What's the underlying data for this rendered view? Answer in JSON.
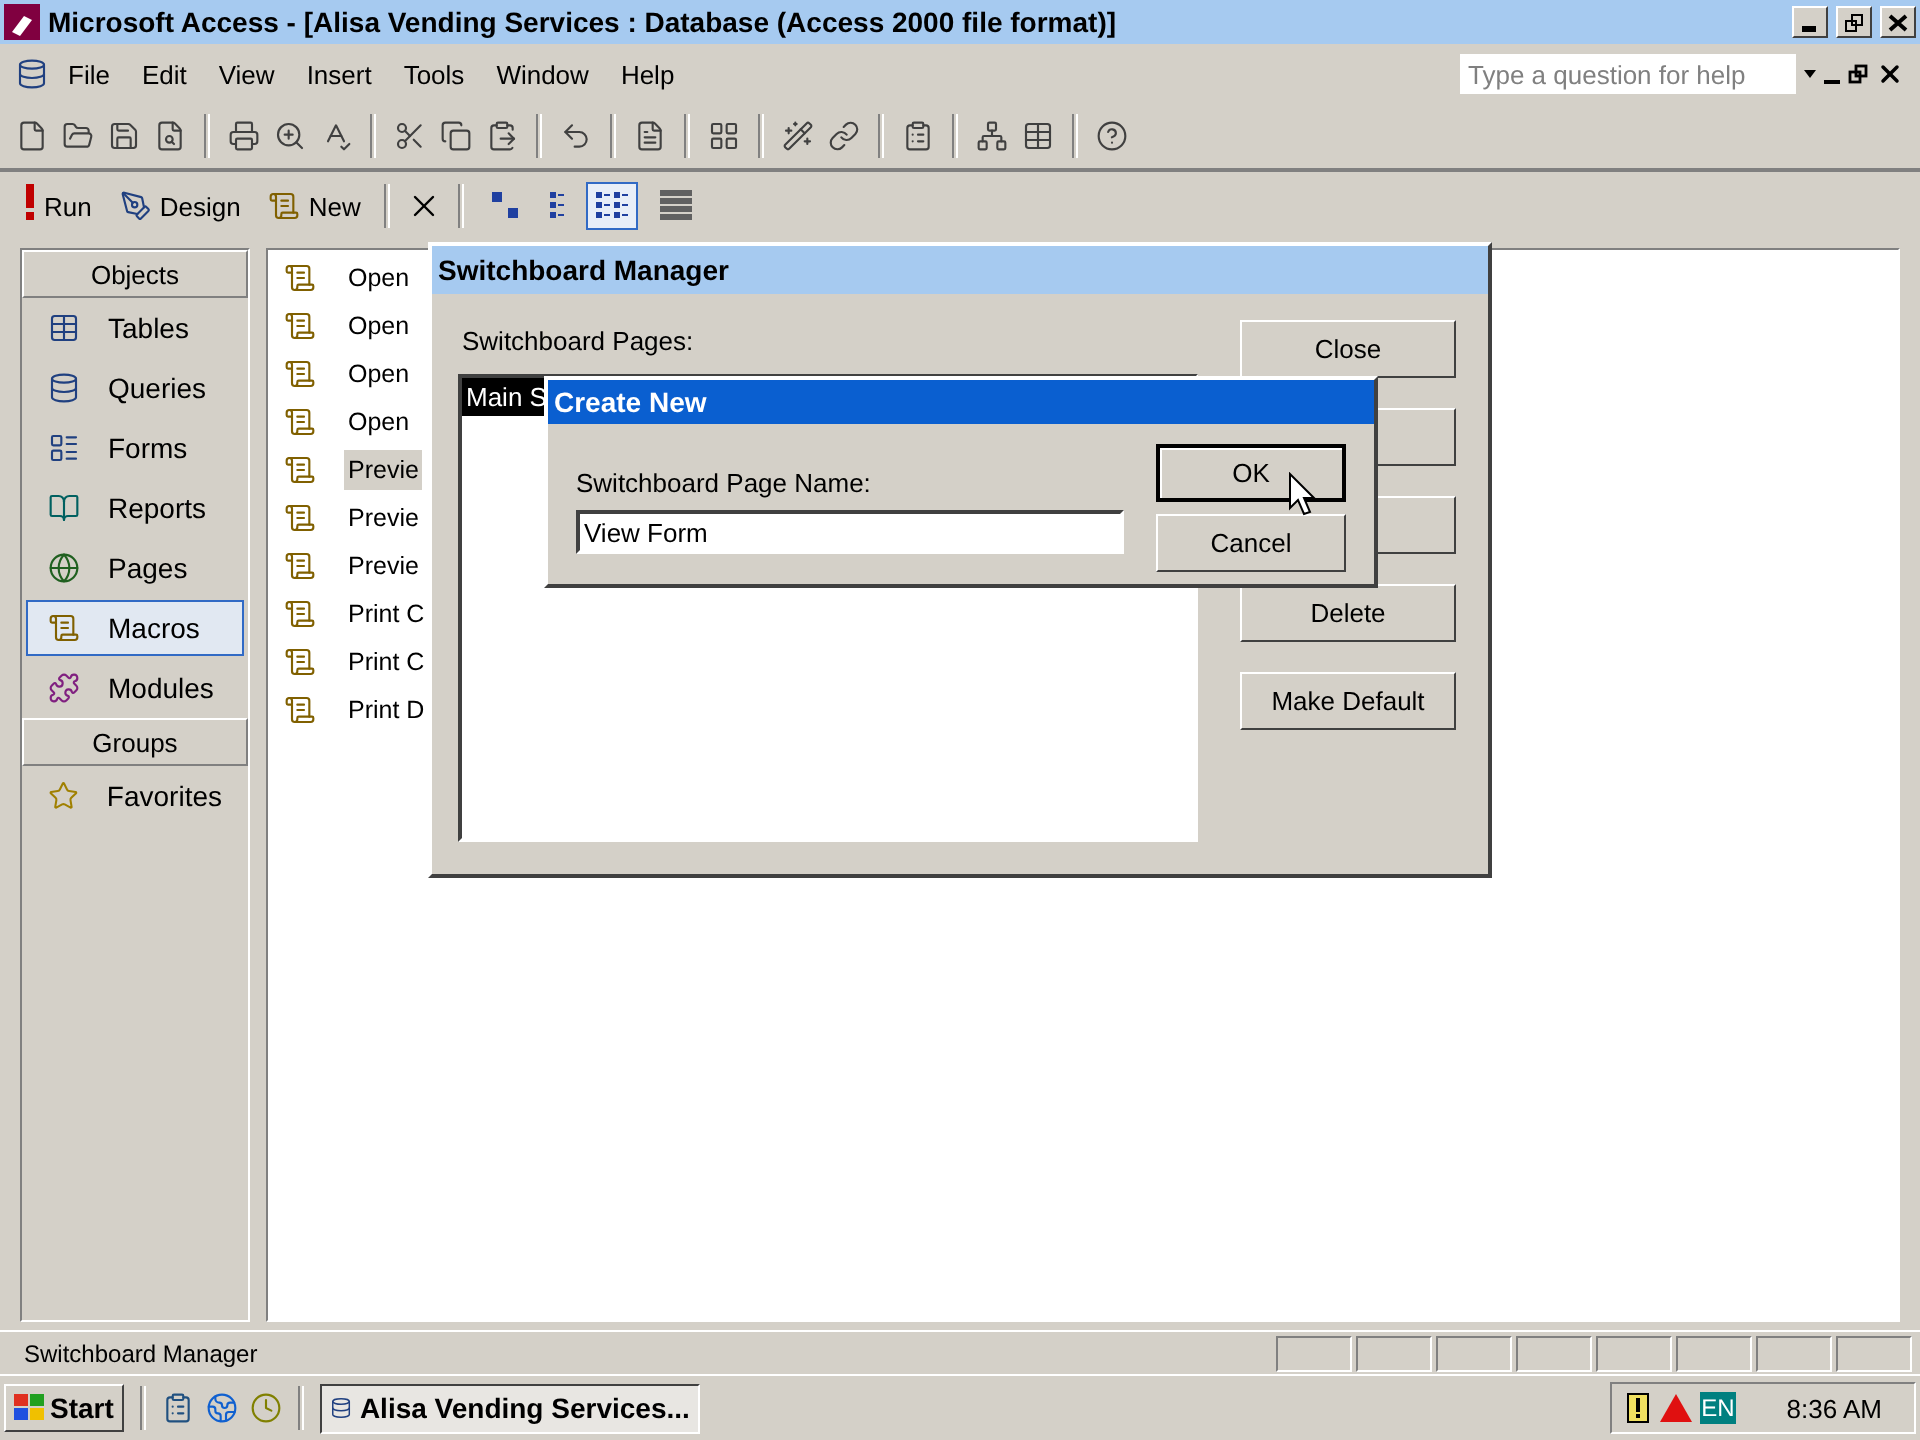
{
  "window": {
    "title": "Microsoft Access - [Alisa Vending Services : Database (Access 2000 file format)]"
  },
  "menu": [
    "File",
    "Edit",
    "View",
    "Insert",
    "Tools",
    "Window",
    "Help"
  ],
  "help_box": {
    "placeholder": "Type a question for help"
  },
  "database_toolbar": {
    "buttons": [
      {
        "label": "Run",
        "kind": "run"
      },
      {
        "label": "Design",
        "kind": "design"
      },
      {
        "label": "New",
        "kind": "new"
      }
    ],
    "views": [
      {
        "kind": "large",
        "selected": false
      },
      {
        "kind": "small",
        "selected": false
      },
      {
        "kind": "list",
        "selected": true
      },
      {
        "kind": "details",
        "selected": false
      }
    ]
  },
  "objects_bar": {
    "header": "Objects",
    "items": [
      {
        "label": "Tables",
        "kind": "tables",
        "selected": false
      },
      {
        "label": "Queries",
        "kind": "queries",
        "selected": false
      },
      {
        "label": "Forms",
        "kind": "forms",
        "selected": false
      },
      {
        "label": "Reports",
        "kind": "reports",
        "selected": false
      },
      {
        "label": "Pages",
        "kind": "pages",
        "selected": false
      },
      {
        "label": "Macros",
        "kind": "macros",
        "selected": true
      },
      {
        "label": "Modules",
        "kind": "modules",
        "selected": false
      }
    ],
    "groups_header": "Groups",
    "groups": [
      {
        "label": "Favorites",
        "kind": "favorites",
        "selected": false
      }
    ]
  },
  "macros": [
    {
      "name": "Open",
      "selected": false
    },
    {
      "name": "Open",
      "selected": false
    },
    {
      "name": "Open",
      "selected": false
    },
    {
      "name": "Open",
      "selected": false
    },
    {
      "name": "Previe",
      "selected": true
    },
    {
      "name": "Previe",
      "selected": false
    },
    {
      "name": "Previe",
      "selected": false
    },
    {
      "name": "Print C",
      "selected": false
    },
    {
      "name": "Print C",
      "selected": false
    },
    {
      "name": "Print D",
      "selected": false
    }
  ],
  "switchboard_manager": {
    "title": "Switchboard Manager",
    "pages_label": "Switchboard Pages:",
    "pages": [
      {
        "name": "Main S",
        "selected": true
      }
    ],
    "buttons": [
      {
        "kind": "button",
        "label": "Close"
      },
      {
        "kind": "covered"
      },
      {
        "kind": "covered"
      },
      {
        "kind": "button",
        "label": "Delete"
      },
      {
        "kind": "button",
        "label": "Make Default"
      }
    ]
  },
  "create_new": {
    "title": "Create New",
    "label": "Switchboard Page Name:",
    "value": "View Form",
    "buttons": [
      {
        "label": "OK",
        "default": true
      },
      {
        "label": "Cancel",
        "default": false
      }
    ]
  },
  "status_bar": {
    "text": "Switchboard Manager"
  },
  "taskbar": {
    "start": "Start",
    "task": "Alisa Vending Services...",
    "language": "EN",
    "clock": "8:36 AM"
  }
}
